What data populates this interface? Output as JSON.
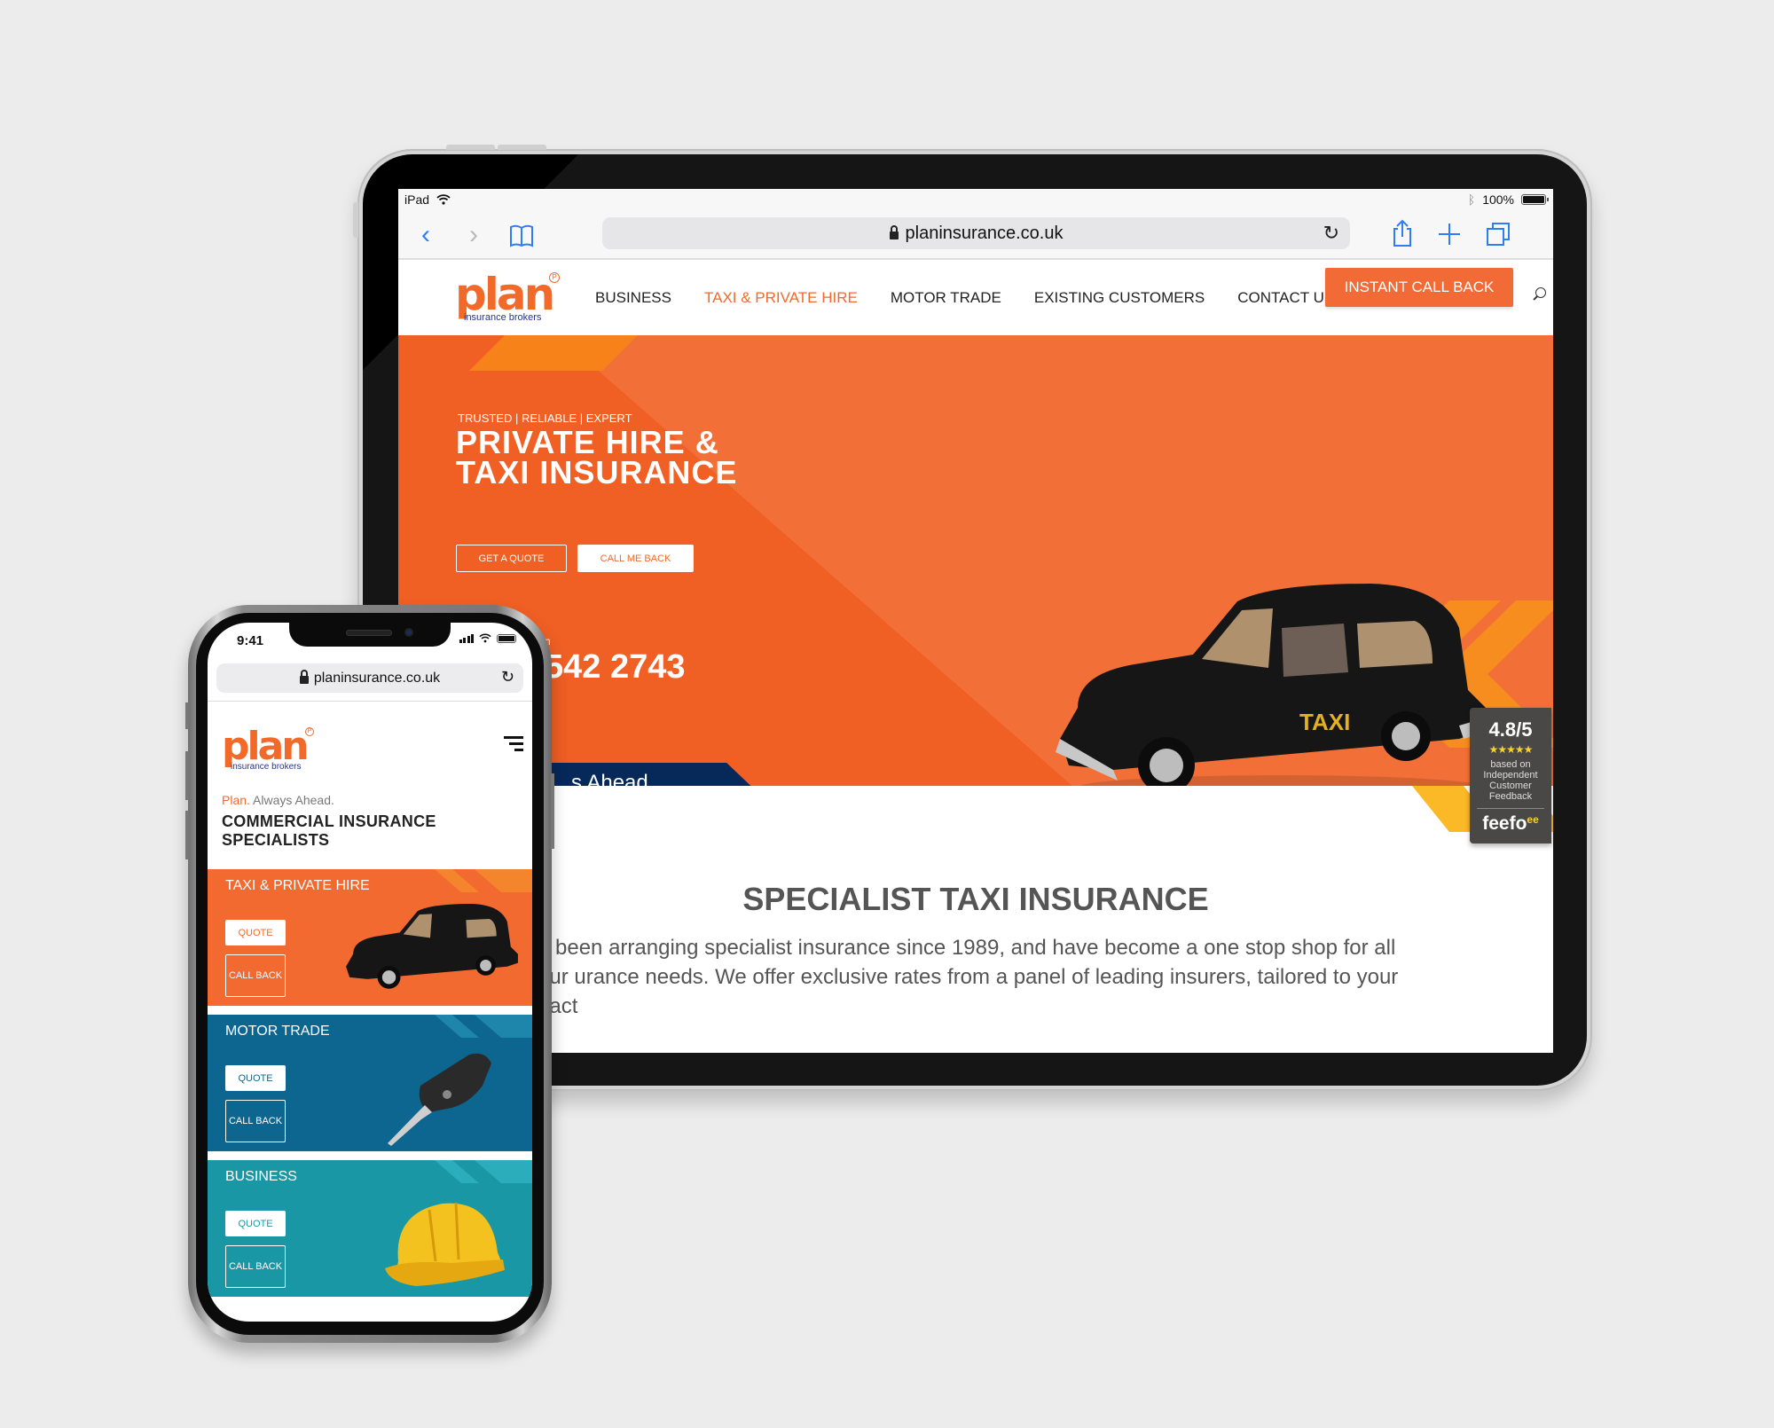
{
  "tablet": {
    "status_bar": {
      "device": "iPad",
      "battery": "100%",
      "battery_level": 1.0
    },
    "browser": {
      "url": "planinsurance.co.uk"
    },
    "site": {
      "logo": {
        "word": "plan",
        "sub": "insurance brokers",
        "reg": "P"
      },
      "nav": [
        {
          "label": "BUSINESS",
          "active": false
        },
        {
          "label": "TAXI & PRIVATE HIRE",
          "active": true
        },
        {
          "label": "MOTOR TRADE",
          "active": false
        },
        {
          "label": "EXISTING CUSTOMERS",
          "active": false
        },
        {
          "label": "CONTACT US",
          "active": false
        }
      ],
      "cta": "INSTANT CALL BACK",
      "hero": {
        "tagline": "TRUSTED | RELIABLE | EXPERT",
        "title_line1": "PRIVATE HIRE &",
        "title_line2": "TAXI INSURANCE",
        "quote_button": "GET A QUOTE",
        "callback_button": "CALL ME BACK",
        "call_label_fragment": "n",
        "phone_fragment": "542 2743",
        "banner_fragment": "s Ahead.",
        "taxi_sign": "TAXI"
      },
      "section": {
        "heading": "SPECIALIST TAXI INSURANCE",
        "body": "ve been arranging specialist insurance since 1989, and have become a one stop shop for all your urance needs. We offer exclusive rates from a panel of leading insurers, tailored to your exact"
      },
      "feefo": {
        "score": "4.8/5",
        "stars": "★★★★★",
        "line1": "based on",
        "line2": "Independent",
        "line3": "Customer",
        "line4": "Feedback",
        "brand": "feefo",
        "eyes": "ee"
      }
    }
  },
  "phone": {
    "status_bar": {
      "time": "9:41",
      "battery_level": 1.0
    },
    "browser": {
      "url": "planinsurance.co.uk"
    },
    "site": {
      "logo": {
        "word": "plan",
        "sub": "insurance brokers",
        "reg": "P"
      },
      "tagline_brand": "Plan.",
      "tagline_rest": " Always Ahead.",
      "title_line1": "COMMERCIAL INSURANCE",
      "title_line2": "SPECIALISTS",
      "cards": [
        {
          "label": "TAXI & PRIVATE HIRE",
          "quote": "QUOTE",
          "callback": "CALL BACK",
          "color": "#f26a2f",
          "accent": "#f26a2a",
          "art": "taxi"
        },
        {
          "label": "MOTOR TRADE",
          "quote": "QUOTE",
          "callback": "CALL BACK",
          "color": "#0d6690",
          "accent": "#0d6690",
          "art": "car-key"
        },
        {
          "label": "BUSINESS",
          "quote": "QUOTE",
          "callback": "CALL BACK",
          "color": "#1a97a4",
          "accent": "#1a97a4",
          "art": "hard-hat"
        }
      ]
    }
  },
  "colors": {
    "brand_orange": "#f26a2f",
    "navy": "#06295a",
    "accent_yellow": "#fbb827",
    "ios_blue": "#2f7df6"
  }
}
